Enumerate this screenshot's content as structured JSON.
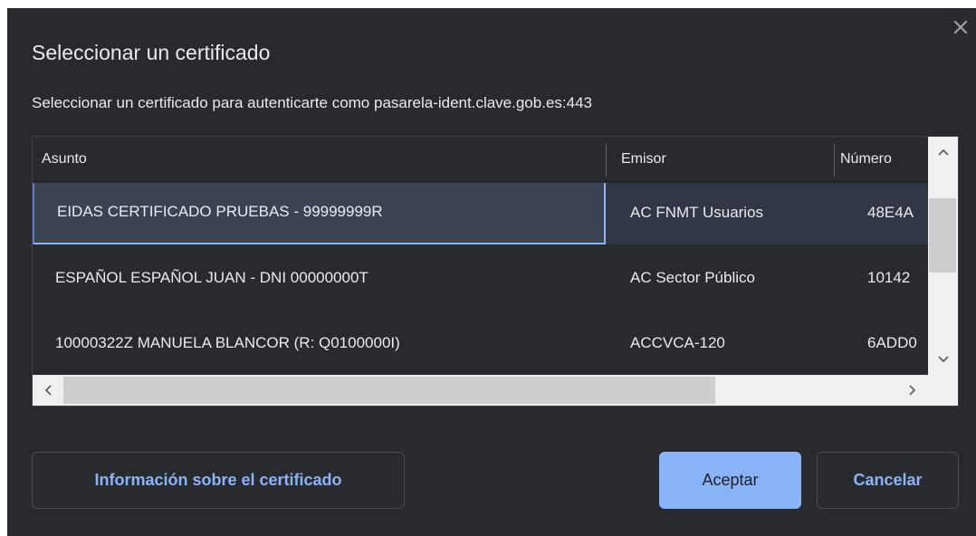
{
  "dialog": {
    "title": "Seleccionar un certificado",
    "subtitle": "Seleccionar un certificado para autenticarte como pasarela-ident.clave.gob.es:443",
    "close_icon": "close-icon"
  },
  "table": {
    "headers": [
      "Asunto",
      "Emisor",
      "Número"
    ],
    "rows": [
      {
        "asunto": "EIDAS CERTIFICADO PRUEBAS - 99999999R",
        "emisor": "AC FNMT Usuarios",
        "numero": "48E4A",
        "selected": true
      },
      {
        "asunto": "ESPAÑOL ESPAÑOL JUAN - DNI 00000000T",
        "emisor": "AC Sector Público",
        "numero": "10142",
        "selected": false
      },
      {
        "asunto": "10000322Z MANUELA BLANCOR (R: Q0100000I)",
        "emisor": "ACCVCA-120",
        "numero": "6ADD0",
        "selected": false
      }
    ]
  },
  "buttons": {
    "info_label": "Información sobre el certificado",
    "ok_label": "Aceptar",
    "cancel_label": "Cancelar"
  },
  "colors": {
    "background": "#292a2d",
    "accent": "#8ab4f8",
    "selected_row": "#3b4252",
    "text": "#e8eaed"
  }
}
